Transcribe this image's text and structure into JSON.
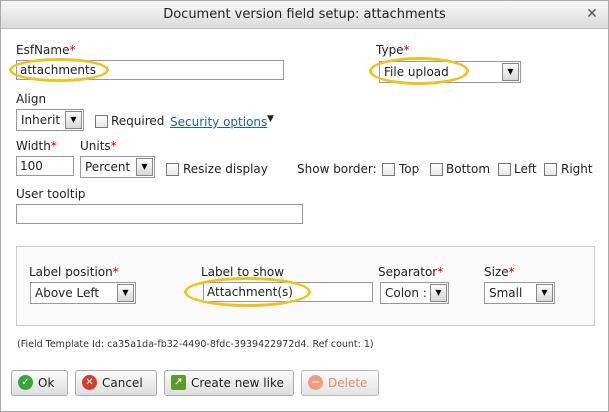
{
  "dialog": {
    "title": "Document version field setup: attachments",
    "close_glyph": "✕"
  },
  "fields": {
    "esfname_label": "EsfName",
    "esfname_value": "attachments",
    "type_label": "Type",
    "type_value": "File upload",
    "align_label": "Align",
    "align_value": "Inherit",
    "required_label": "Required",
    "security_link": "Security options",
    "width_label": "Width",
    "width_value": "100",
    "units_label": "Units",
    "units_value": "Percent",
    "resize_label": "Resize display",
    "show_border_label": "Show border:",
    "border_top": "Top",
    "border_bottom": "Bottom",
    "border_left": "Left",
    "border_right": "Right",
    "tooltip_label": "User tooltip",
    "tooltip_value": ""
  },
  "label_group": {
    "position_label": "Label position",
    "position_value": "Above Left",
    "label_to_show_label": "Label to show",
    "label_to_show_value": "Attachment(s)",
    "separator_label": "Separator",
    "separator_value": "Colon :",
    "size_label": "Size",
    "size_value": "Small"
  },
  "footer_info": "(Field Template Id: ca35a1da-fb32-4490-8fdc-3939422972d4. Ref count: 1)",
  "buttons": {
    "ok": "Ok",
    "cancel": "Cancel",
    "create_new_like": "Create new like",
    "delete": "Delete"
  },
  "required_marker": "*",
  "colors": {
    "highlight": "#f2c21c",
    "required": "#cc0000",
    "link": "#1a5fb4"
  }
}
